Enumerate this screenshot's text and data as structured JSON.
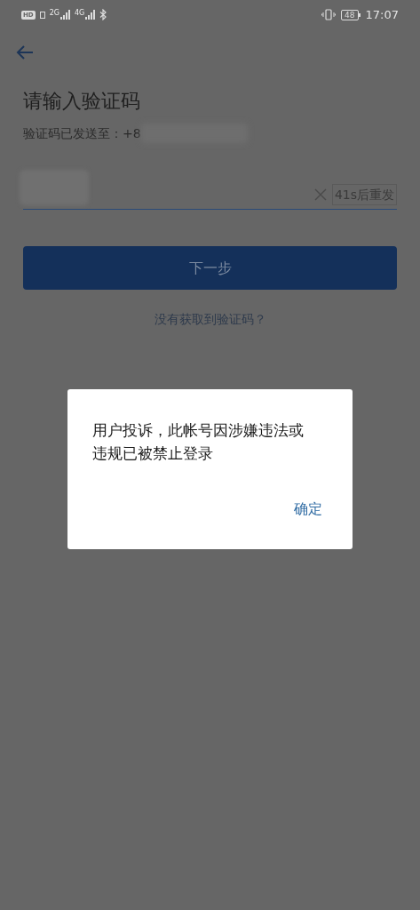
{
  "status_bar": {
    "network_badge": "HD",
    "signals": [
      {
        "label": "2G"
      },
      {
        "label": "4G"
      }
    ],
    "battery": "48",
    "time": "17:07"
  },
  "page": {
    "title": "请输入验证码",
    "sent_to": "验证码已发送至：+8",
    "resend": "41s后重发",
    "next_button": "下一步",
    "help_link": "没有获取到验证码？"
  },
  "dialog": {
    "message": "用户投诉，此帐号因涉嫌违法或违规已被禁止登录",
    "button": "确定"
  }
}
